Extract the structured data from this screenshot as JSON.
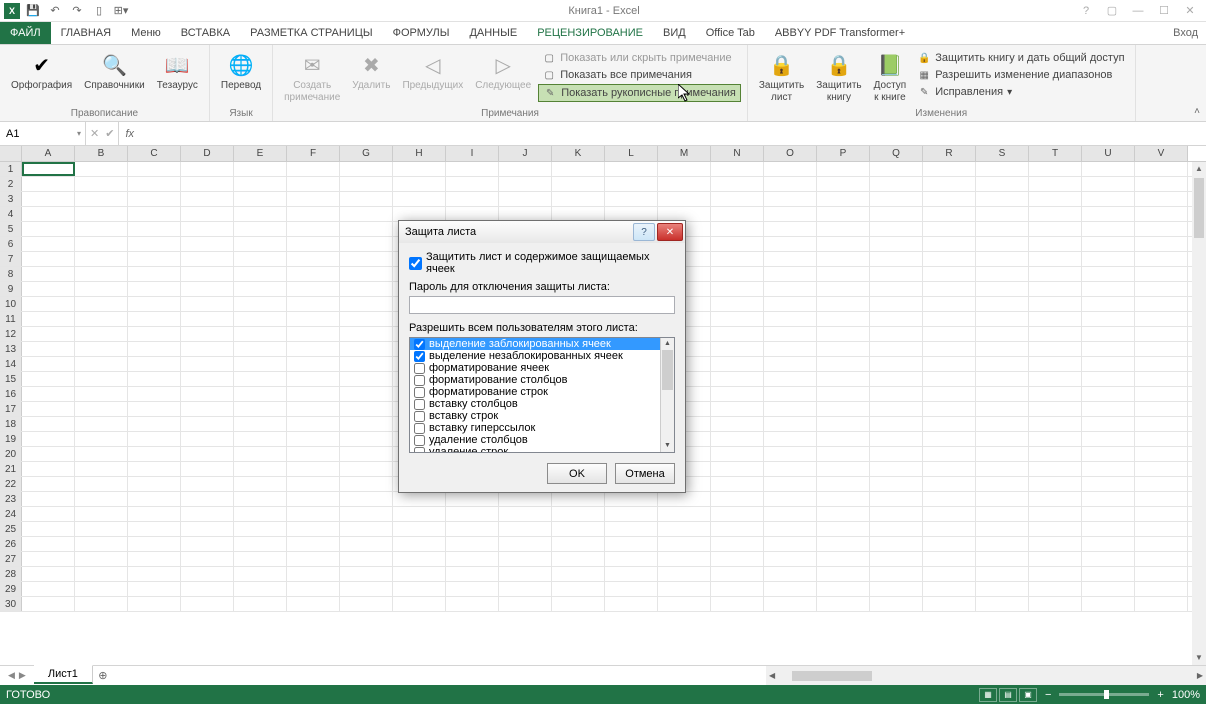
{
  "app": {
    "title": "Книга1 - Excel",
    "signin": "Вход"
  },
  "qat_icons": [
    "save",
    "undo",
    "redo",
    "new",
    "touch"
  ],
  "tabs": {
    "file": "ФАЙЛ",
    "list": [
      "ГЛАВНАЯ",
      "Меню",
      "ВСТАВКА",
      "РАЗМЕТКА СТРАНИЦЫ",
      "ФОРМУЛЫ",
      "ДАННЫЕ",
      "РЕЦЕНЗИРОВАНИЕ",
      "ВИД",
      "Office Tab",
      "ABBYY PDF Transformer+"
    ],
    "active": "РЕЦЕНЗИРОВАНИЕ"
  },
  "ribbon": {
    "proofing": {
      "label": "Правописание",
      "spelling": "Орфография",
      "research": "Справочники",
      "thesaurus": "Тезаурус"
    },
    "language": {
      "label": "Язык",
      "translate": "Перевод"
    },
    "comments": {
      "label": "Примечания",
      "new": "Создать\nпримечание",
      "delete": "Удалить",
      "prev": "Предыдущих",
      "next": "Следующее",
      "showHide": "Показать или скрыть примечание",
      "showAll": "Показать все примечания",
      "showInk": "Показать рукописные примечания"
    },
    "changes": {
      "label": "Изменения",
      "protectSheet": "Защитить\nлист",
      "protectBook": "Защитить\nкнигу",
      "shareBook": "Доступ\nк книге",
      "protectShare": "Защитить книгу и дать общий доступ",
      "allowRanges": "Разрешить изменение диапазонов",
      "track": "Исправления"
    }
  },
  "formula_bar": {
    "name_box": "A1",
    "fx": "fx"
  },
  "columns": [
    "A",
    "B",
    "C",
    "D",
    "E",
    "F",
    "G",
    "H",
    "I",
    "J",
    "K",
    "L",
    "M",
    "N",
    "O",
    "P",
    "Q",
    "R",
    "S",
    "T",
    "U",
    "V"
  ],
  "row_count": 30,
  "sheet": {
    "name": "Лист1"
  },
  "status": {
    "ready": "ГОТОВО",
    "zoom": "100%"
  },
  "dialog": {
    "title": "Защита листа",
    "protect_contents": "Защитить лист и содержимое защищаемых ячеек",
    "password_label": "Пароль для отключения защиты листа:",
    "allow_label": "Разрешить всем пользователям этого листа:",
    "perms": [
      {
        "label": "выделение заблокированных ячеек",
        "checked": true,
        "selected": true
      },
      {
        "label": "выделение незаблокированных ячеек",
        "checked": true
      },
      {
        "label": "форматирование ячеек",
        "checked": false
      },
      {
        "label": "форматирование столбцов",
        "checked": false
      },
      {
        "label": "форматирование строк",
        "checked": false
      },
      {
        "label": "вставку столбцов",
        "checked": false
      },
      {
        "label": "вставку строк",
        "checked": false
      },
      {
        "label": "вставку гиперссылок",
        "checked": false
      },
      {
        "label": "удаление столбцов",
        "checked": false
      },
      {
        "label": "удаление строк",
        "checked": false
      }
    ],
    "ok": "OK",
    "cancel": "Отмена"
  }
}
